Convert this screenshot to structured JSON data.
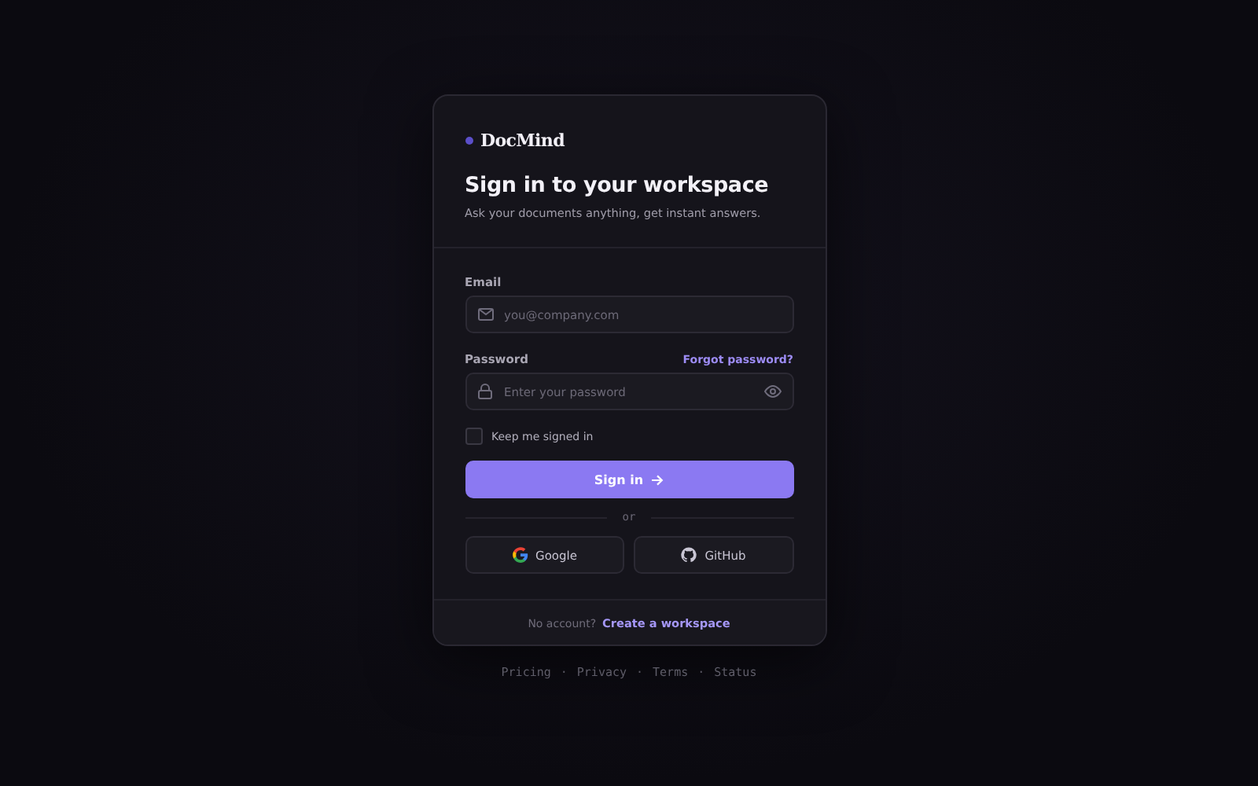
{
  "brand": {
    "name": "DocMind"
  },
  "heading": "Sign in to your workspace",
  "subtitle": "Ask your documents anything, get instant answers.",
  "fields": [
    {
      "kind": "email",
      "label": "Email",
      "placeholder": "you@company.com"
    },
    {
      "kind": "password",
      "label": "Password",
      "placeholder": "Enter your password",
      "link": "Forgot password?"
    }
  ],
  "remember": {
    "label": "Keep me signed in",
    "checked": false
  },
  "submit": {
    "label": "Sign in"
  },
  "divider": "or",
  "providers": [
    {
      "kind": "google",
      "label": "Google"
    },
    {
      "kind": "github",
      "label": "GitHub"
    }
  ],
  "signup": {
    "prompt": "No account?",
    "link": "Create a workspace"
  },
  "footer_separator": "·",
  "footer_links": [
    "Pricing",
    "Privacy",
    "Terms",
    "Status"
  ]
}
